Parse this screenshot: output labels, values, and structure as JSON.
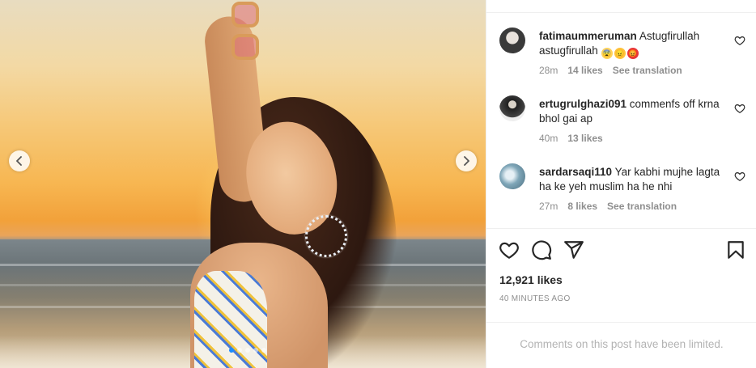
{
  "carousel": {
    "prev_icon": "chevron-left-icon",
    "next_icon": "chevron-right-icon",
    "slide_count": 5,
    "active_index": 0
  },
  "comments": [
    {
      "username": "fatimaummeruman",
      "text": "Astugfirullah astugfirullah",
      "emojis": [
        "😨",
        "😠",
        "😡"
      ],
      "time": "28m",
      "likes": "14 likes",
      "translation": "See translation",
      "avatar_color": "#3a3a3a"
    },
    {
      "username": "ertugrulghazi091",
      "text": "commenfs off krna bhol gai ap",
      "emojis": [],
      "time": "40m",
      "likes": "13 likes",
      "translation": "",
      "avatar_color": "#2b2b2b"
    },
    {
      "username": "sardarsaqi110",
      "text": "Yar kabhi mujhe lagta ha ke yeh muslim ha he nhi",
      "emojis": [],
      "time": "27m",
      "likes": "8 likes",
      "translation": "See translation",
      "avatar_color": "#7fa6b8"
    }
  ],
  "actions": {
    "like_icon": "heart-icon",
    "comment_icon": "comment-icon",
    "share_icon": "send-icon",
    "save_icon": "bookmark-icon"
  },
  "post": {
    "likes_label": "12,921 likes",
    "time_ago": "40 MINUTES AGO",
    "comments_limited": "Comments on this post have been limited."
  },
  "colors": {
    "text": "#262626",
    "secondary": "#8e8e8e",
    "divider": "#efefef",
    "accent": "#1a8cff"
  }
}
